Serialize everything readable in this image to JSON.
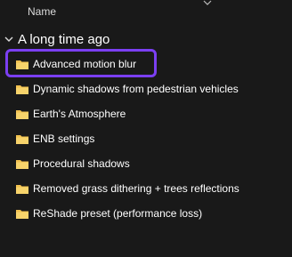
{
  "header": {
    "name_column": "Name"
  },
  "group": {
    "title": "A long time ago"
  },
  "items": [
    {
      "label": "Advanced motion blur"
    },
    {
      "label": "Dynamic shadows from pedestrian vehicles"
    },
    {
      "label": "Earth's Atmosphere"
    },
    {
      "label": "ENB settings"
    },
    {
      "label": "Procedural shadows"
    },
    {
      "label": "Removed grass dithering + trees reflections"
    },
    {
      "label": "ReShade preset (performance loss)"
    }
  ],
  "colors": {
    "background": "#191919",
    "folder": "#f2c14e",
    "highlight": "#7b3ff2"
  }
}
